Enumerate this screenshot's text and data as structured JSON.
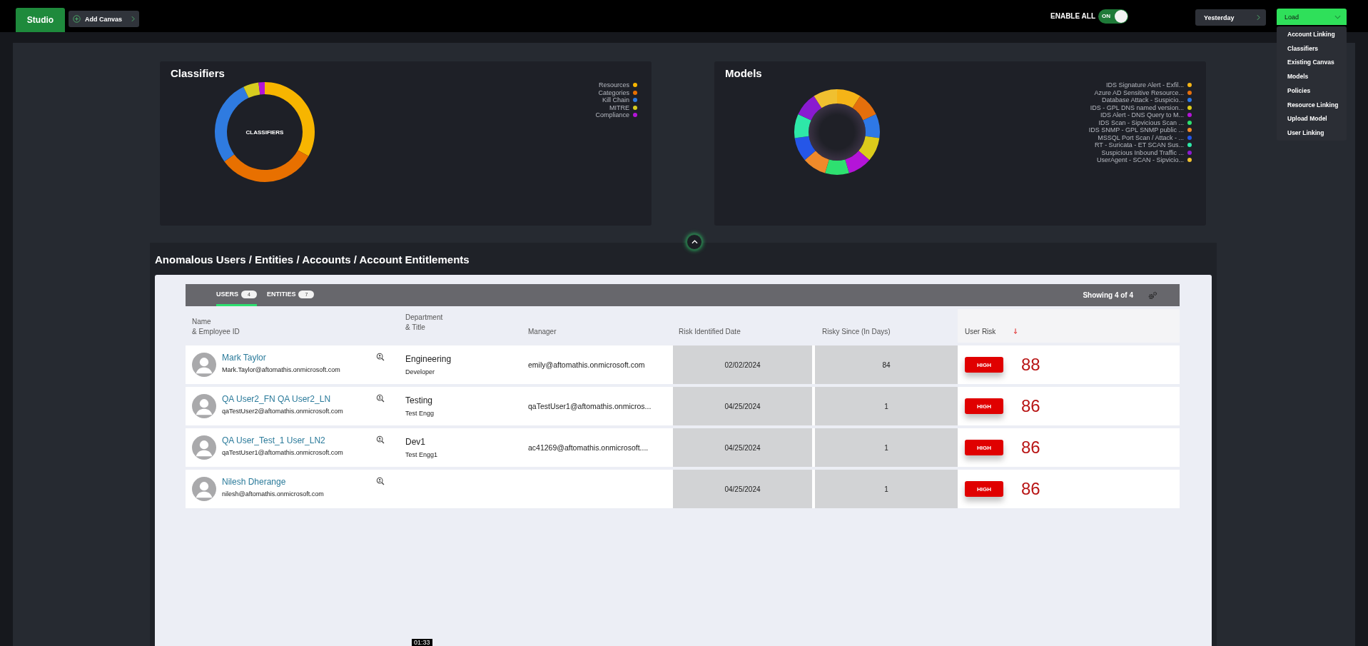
{
  "topbar": {
    "studio_tab": {
      "label": "Studio",
      "selected": true
    },
    "add_canvas": "Add Canvas",
    "enable_all": {
      "label": "ENABLE ALL",
      "toggle_text": "ON",
      "on": true
    },
    "range": "Yesterday",
    "load": {
      "label": "Load",
      "expanded": true,
      "options": [
        "Account Linking",
        "Classifiers",
        "Existing Canvas",
        "Models",
        "Policies",
        "Resource Linking",
        "Upload Model",
        "User Linking"
      ]
    }
  },
  "cards": [
    {
      "title": "Classifiers",
      "center_label": "CLASSIFIERS",
      "legend": [
        {
          "name": "Resources",
          "color": "#f7b500"
        },
        {
          "name": "Categories",
          "color": "#e87000"
        },
        {
          "name": "Kill Chain",
          "color": "#2f7be0"
        },
        {
          "name": "MITRE",
          "color": "#d7cc1f"
        },
        {
          "name": "Compliance",
          "color": "#b414d8"
        }
      ]
    },
    {
      "title": "Models",
      "legend": [
        {
          "name": "IDS Signature Alert - Exfil...",
          "color": "#f5b417"
        },
        {
          "name": "Azure AD Sensitive Resource...",
          "color": "#e56f0c"
        },
        {
          "name": "Database Attack - Suspicio...",
          "color": "#2e78e6"
        },
        {
          "name": "IDS - GPL DNS named version...",
          "color": "#dccb1b"
        },
        {
          "name": "IDS Alert - DNS Query to M...",
          "color": "#b414d8"
        },
        {
          "name": "IDS Scan - Sipvicious Scan ...",
          "color": "#2ee070"
        },
        {
          "name": "IDS SNMP - GPL SNMP public ...",
          "color": "#f08a2a"
        },
        {
          "name": "MSSQL Port Scan / Attack - ...",
          "color": "#2556e8"
        },
        {
          "name": "RT - Suricata - ET SCAN Sus...",
          "color": "#2ee8a8"
        },
        {
          "name": "Suspicious Inbound Traffic ...",
          "color": "#8a1ad0"
        },
        {
          "name": "UserAgent - SCAN - Sipvicio...",
          "color": "#f0c030"
        }
      ]
    }
  ],
  "section": {
    "title": "Anomalous Users / Entities / Accounts / Account Entitlements",
    "tabs": [
      {
        "label": "USERS",
        "count": "4",
        "selected": true
      },
      {
        "label": "ENTITIES",
        "count": "7",
        "selected": false
      }
    ],
    "showing": "Showing 4 of 4",
    "columns": [
      {
        "lines": [
          "Name",
          "& Employee ID"
        ],
        "sorted": false
      },
      {
        "lines": [
          "Department",
          "& Title"
        ],
        "sorted": false
      },
      {
        "lines": [
          "Manager"
        ],
        "sorted": false
      },
      {
        "lines": [
          "Risk Identified Date"
        ],
        "sorted": false
      },
      {
        "lines": [
          "Risky Since (In Days)"
        ],
        "sorted": false
      },
      {
        "lines": [
          "User Risk"
        ],
        "sorted": true
      }
    ],
    "rows": [
      {
        "name": "Mark Taylor",
        "email": "Mark.Taylor@aftomathis.onmicrosoft.com",
        "department": "Engineering",
        "title": "Developer",
        "manager": "emily@aftomathis.onmicrosoft.com",
        "date": "02/02/2024",
        "days": "84",
        "risk_level": "HIGH",
        "score": "88"
      },
      {
        "name": "QA User2_FN QA User2_LN",
        "email": "qaTestUser2@aftomathis.onmicrosoft.com",
        "department": "Testing",
        "title": "Test Engg",
        "manager": "qaTestUser1@aftomathis.onmicros...",
        "date": "04/25/2024",
        "days": "1",
        "risk_level": "HIGH",
        "score": "86"
      },
      {
        "name": "QA User_Test_1 User_LN2",
        "email": "qaTestUser1@aftomathis.onmicrosoft.com",
        "department": "Dev1",
        "title": "Test Engg1",
        "manager": "ac41269@aftomathis.onmicrosoft....",
        "date": "04/25/2024",
        "days": "1",
        "risk_level": "HIGH",
        "score": "86"
      },
      {
        "name": "Nilesh Dherange",
        "email": "nilesh@aftomathis.onmicrosoft.com",
        "date": "04/25/2024",
        "days": "1",
        "risk_level": "HIGH",
        "score": "86"
      }
    ]
  },
  "timestamp": "01:33"
}
